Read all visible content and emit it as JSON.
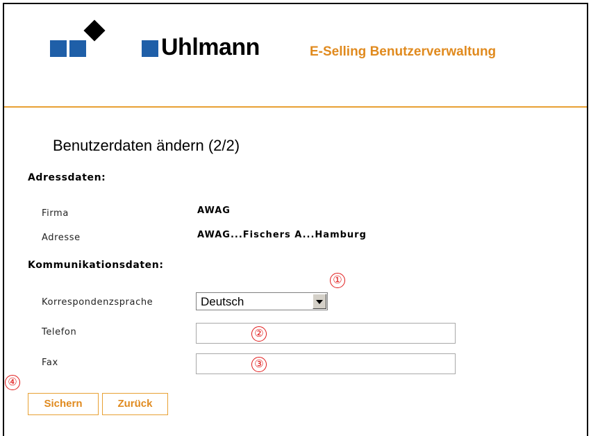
{
  "header": {
    "brand": "Uhlmann",
    "app_title": "E-Selling Benutzerverwaltung"
  },
  "page_title": "Benutzerdaten ändern (2/2)",
  "address_section": {
    "heading": "Adressdaten:",
    "company_label": "Firma",
    "company_value": "AWAG",
    "address_label": "Adresse",
    "address_value": "AWAG...Fischers A...Hamburg"
  },
  "communication_section": {
    "heading": "Kommunikationsdaten:",
    "language_label": "Korrespondenzsprache",
    "language_value": "Deutsch",
    "phone_label": "Telefon",
    "phone_value": "",
    "fax_label": "Fax",
    "fax_value": ""
  },
  "markers": [
    "①",
    "②",
    "③",
    "④"
  ],
  "actions": {
    "save": "Sichern",
    "back": "Zurück"
  },
  "colors": {
    "accent": "#e08a1e",
    "brand_blue": "#1f5fa8",
    "marker_red": "#e01818"
  }
}
